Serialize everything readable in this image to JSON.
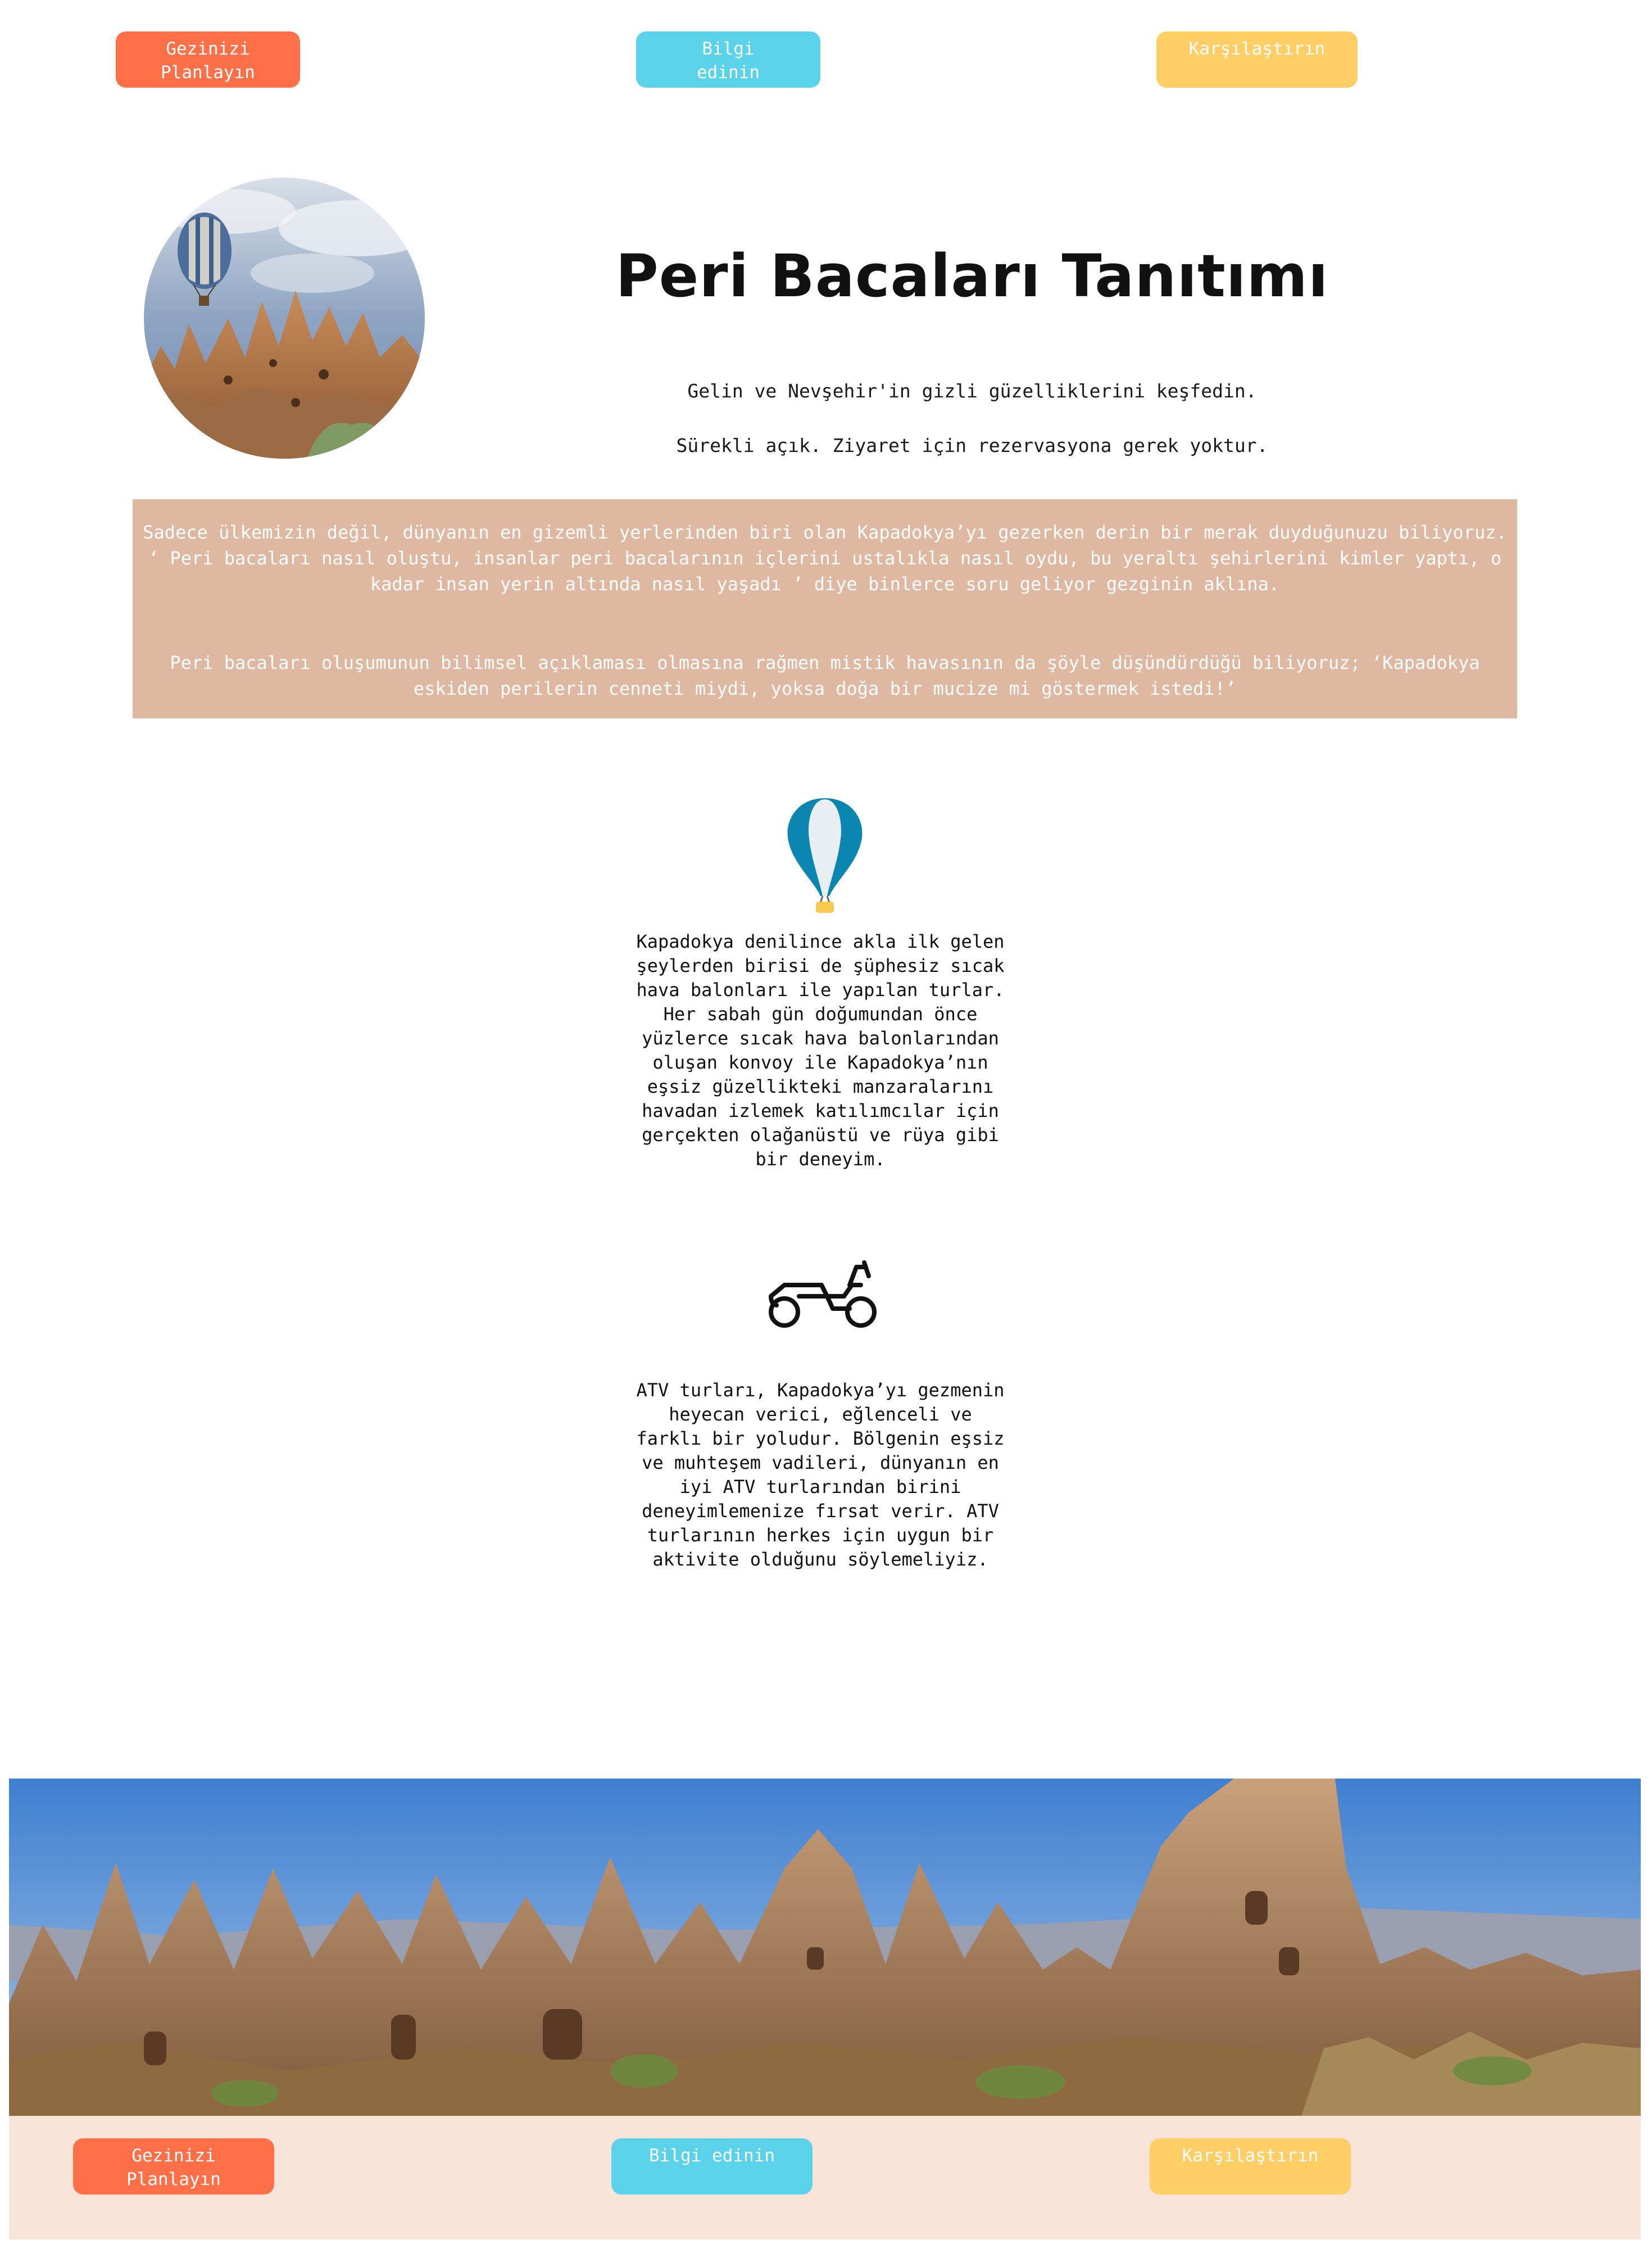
{
  "top_nav": {
    "plan_label": "Gezinizi\nPlanlayın",
    "info_label": "Bilgi\nedinin",
    "compare_label": "Karşılaştırın"
  },
  "hero": {
    "title": "Peri Bacaları Tanıtımı",
    "line1": "Gelin ve Nevşehir'in gizli güzelliklerini keşfedin.",
    "line2": "Sürekli açık. Ziyaret için rezervasyona gerek yoktur."
  },
  "story": {
    "p1": "Sadece ülkemizin değil, dünyanın en gizemli yerlerinden biri olan Kapadokya’yı gezerken derin bir merak duyduğunuzu biliyoruz. ‘ Peri bacaları nasıl oluştu, insanlar peri bacalarının içlerini ustalıkla nasıl oydu, bu yeraltı şehirlerini kimler yaptı, o kadar insan yerin altında nasıl yaşadı ’ diye binlerce soru geliyor gezginin aklına.",
    "p2": "Peri bacaları oluşumunun bilimsel açıklaması olmasına rağmen mistik havasının da şöyle düşündürdüğü biliyoruz; ‘Kapadokya eskiden perilerin cenneti miydi, yoksa doğa bir mucize mi göstermek istedi!’"
  },
  "features": [
    {
      "icon": "hot-air-balloon-icon",
      "text": "Kapadokya denilince akla ilk gelen şeylerden birisi de şüphesiz sıcak hava balonları ile yapılan turlar. Her sabah gün doğumundan önce yüzlerce sıcak hava balonlarından oluşan konvoy ile Kapadokya’nın eşsiz güzellikteki manzaralarını havadan izlemek katılımcılar için gerçekten olağanüstü ve rüya gibi bir deneyim."
    },
    {
      "icon": "atv-icon",
      "text": "ATV turları, Kapadokya’yı gezmenin heyecan verici, eğlenceli ve farklı bir yoludur. Bölgenin eşsiz ve muhteşem vadileri, dünyanın en iyi ATV turlarından birini deneyimlemenize fırsat verir. ATV turlarının herkes için uygun bir aktivite olduğunu söylemeliyiz."
    }
  ],
  "footer_nav": {
    "plan_label": "Gezinizi\nPlanlayın",
    "info_label": "Bilgi edinin",
    "compare_label": "Karşılaştırın"
  },
  "colors": {
    "orange": "#FF7049",
    "blue": "#5AD2EA",
    "yellow": "#FFCF66",
    "story_bg": "#DEB8A0",
    "footer_bg": "#F8E4D8"
  }
}
